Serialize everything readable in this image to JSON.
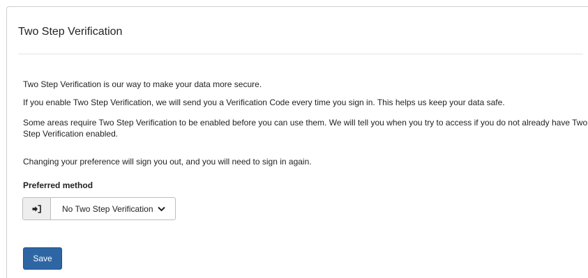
{
  "panel": {
    "title": "Two Step Verification"
  },
  "content": {
    "paragraphs": [
      "Two Step Verification is our way to make your data more secure.",
      "If you enable Two Step Verification, we will send you a Verification Code every time you sign in. This helps us keep your data safe.",
      "Some areas require Two Step Verification to be enabled before you can use them. We will tell you when you try to access if you do not already have Two Step Verification enabled.",
      "Changing your preference will sign you out, and you will need to sign in again."
    ]
  },
  "preferred_method": {
    "label": "Preferred method",
    "addon_icon": "sign-in-icon",
    "selected": "No Two Step Verification",
    "caret_icon": "chevron-down-icon"
  },
  "actions": {
    "save_label": "Save"
  },
  "colors": {
    "primary_button": "#2e66a4",
    "addon_background": "#eeeeee"
  }
}
